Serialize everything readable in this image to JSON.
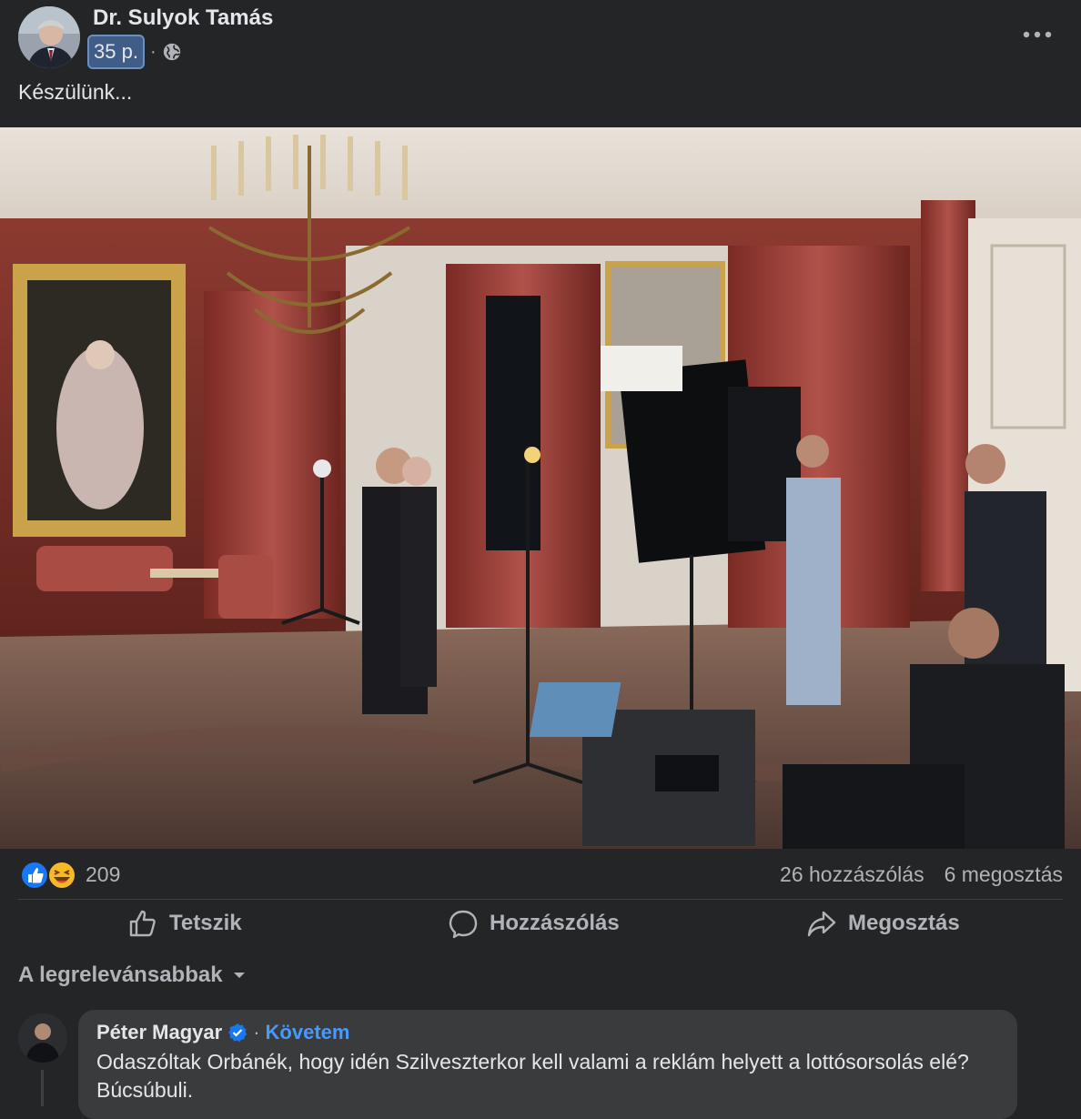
{
  "post": {
    "author": "Dr. Sulyok Tamás",
    "time": "35 p.",
    "separator": "·",
    "privacy_icon": "globe-icon",
    "more_icon": "more-horizontal-icon",
    "text": "Készülünk..."
  },
  "photo": {
    "icon": "photo-image"
  },
  "reactions": {
    "icons": [
      "like-reaction-icon",
      "haha-reaction-icon"
    ],
    "count": "209",
    "comments": "26 hozzászólás",
    "shares": "6 megosztás"
  },
  "actions": {
    "like_label": "Tetszik",
    "comment_label": "Hozzászólás",
    "share_label": "Megosztás"
  },
  "sort": {
    "label": "A legrelevánsabbak",
    "icon": "caret-down-icon"
  },
  "comment": {
    "author": "Péter Magyar",
    "verified_icon": "verified-badge-icon",
    "separator": "·",
    "follow_label": "Követem",
    "text": "Odaszóltak Orbánék, hogy idén Szilveszterkor kell valami a reklám helyett a lottósorsolás elé? Búcsúbuli."
  },
  "colors": {
    "background": "#242526",
    "text_primary": "#e4e6eb",
    "text_secondary": "#b0b3b8",
    "link_blue": "#4599ff",
    "bubble": "#3a3b3c",
    "time_highlight": "#3f5d86"
  }
}
